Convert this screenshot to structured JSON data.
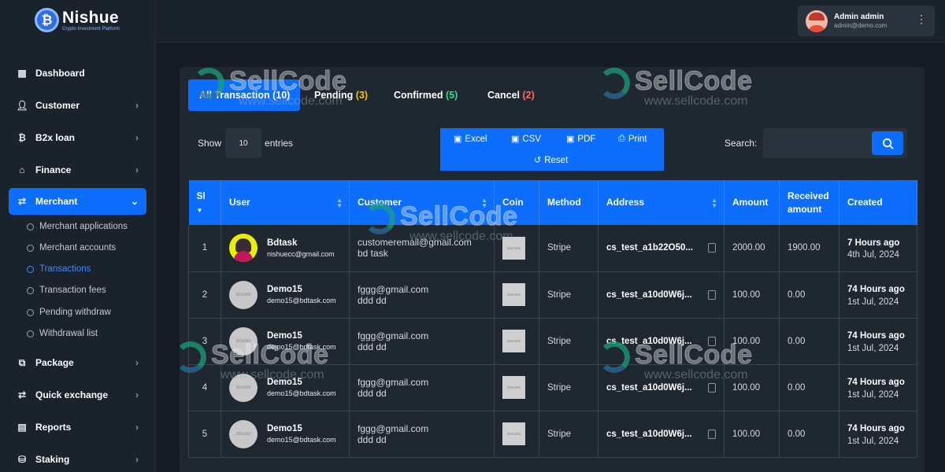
{
  "brand": {
    "name": "Nishue",
    "tagline": "Crypto Investment Platform"
  },
  "topbar": {
    "user_name": "Admin admin",
    "user_email": "admin@demo.com"
  },
  "sidebar": {
    "items": [
      {
        "label": "Dashboard",
        "icon": "grid-icon"
      },
      {
        "label": "Customer",
        "icon": "user-icon"
      },
      {
        "label": "B2x loan",
        "icon": "bitcoin-icon"
      },
      {
        "label": "Finance",
        "icon": "bank-icon"
      },
      {
        "label": "Merchant",
        "icon": "exchange-icon"
      },
      {
        "label": "Package",
        "icon": "package-icon"
      },
      {
        "label": "Quick exchange",
        "icon": "exchange-icon"
      },
      {
        "label": "Reports",
        "icon": "report-icon"
      },
      {
        "label": "Staking",
        "icon": "staking-icon"
      }
    ],
    "merchant_sub": [
      "Merchant applications",
      "Merchant accounts",
      "Transactions",
      "Transaction fees",
      "Pending withdraw",
      "Withdrawal list"
    ]
  },
  "tabs": [
    {
      "label": "All Transaction",
      "count": "(10)"
    },
    {
      "label": "Pending",
      "count": "(3)"
    },
    {
      "label": "Confirmed",
      "count": "(5)"
    },
    {
      "label": "Cancel",
      "count": "(2)"
    }
  ],
  "controls": {
    "show_label": "Show",
    "entries_value": "10",
    "entries_label": "entries",
    "search_label": "Search:",
    "export": {
      "excel": "Excel",
      "csv": "CSV",
      "pdf": "PDF",
      "print": "Print",
      "reset": "Reset"
    }
  },
  "table": {
    "headers": [
      "Sl",
      "User",
      "Customer",
      "Coin",
      "Method",
      "Address",
      "Amount",
      "Received amount",
      "Created"
    ],
    "rows": [
      {
        "sl": "1",
        "user_name": "Bdtask",
        "user_email": "nishuecc@gmail.com",
        "cust_email": "customeremail@gmail.com",
        "cust_name": "bd task",
        "coin": "360x360",
        "method": "Stripe",
        "address": "cs_test_a1b22O50...",
        "amount": "2000.00",
        "received": "1900.00",
        "created_ago": "7 Hours ago",
        "created_date": "4th Jul, 2024"
      },
      {
        "sl": "2",
        "user_name": "Demo15",
        "user_email": "demo15@bdtask.com",
        "cust_email": "fggg@gmail.com",
        "cust_name": "ddd dd",
        "coin": "360x360",
        "method": "Stripe",
        "address": "cs_test_a10d0W6j...",
        "amount": "100.00",
        "received": "0.00",
        "created_ago": "74 Hours ago",
        "created_date": "1st Jul, 2024"
      },
      {
        "sl": "3",
        "user_name": "Demo15",
        "user_email": "demo15@bdtask.com",
        "cust_email": "fggg@gmail.com",
        "cust_name": "ddd dd",
        "coin": "360x360",
        "method": "Stripe",
        "address": "cs_test_a10d0W6j...",
        "amount": "100.00",
        "received": "0.00",
        "created_ago": "74 Hours ago",
        "created_date": "1st Jul, 2024"
      },
      {
        "sl": "4",
        "user_name": "Demo15",
        "user_email": "demo15@bdtask.com",
        "cust_email": "fggg@gmail.com",
        "cust_name": "ddd dd",
        "coin": "360x360",
        "method": "Stripe",
        "address": "cs_test_a10d0W6j...",
        "amount": "100.00",
        "received": "0.00",
        "created_ago": "74 Hours ago",
        "created_date": "1st Jul, 2024"
      },
      {
        "sl": "5",
        "user_name": "Demo15",
        "user_email": "demo15@bdtask.com",
        "cust_email": "fggg@gmail.com",
        "cust_name": "ddd dd",
        "coin": "360x360",
        "method": "Stripe",
        "address": "cs_test_a10d0W6j...",
        "amount": "100.00",
        "received": "0.00",
        "created_ago": "74 Hours ago",
        "created_date": "1st Jul, 2024"
      }
    ]
  },
  "watermark": {
    "text": "SellCode",
    "url": "www.sellcode.com"
  },
  "colors": {
    "accent": "#0d6efd",
    "pending": "#ffc107",
    "confirmed": "#3ddc84",
    "cancel": "#ff6b6b"
  }
}
